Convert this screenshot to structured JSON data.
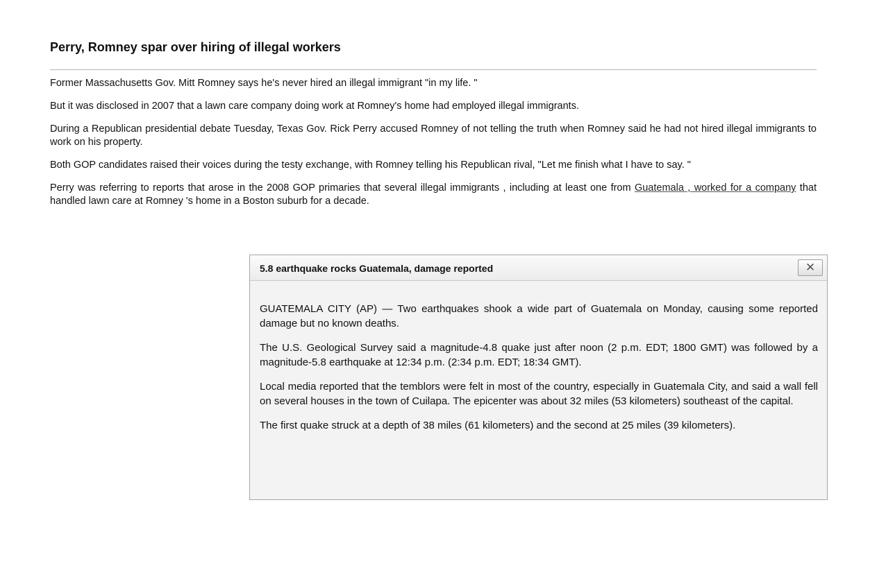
{
  "article": {
    "headline": "Perry, Romney spar over hiring of illegal workers",
    "paragraphs": [
      "Former Massachusetts Gov. Mitt Romney says he's never hired an illegal immigrant \"in my life. \"",
      "But it was disclosed in 2007 that a lawn care company doing work at Romney's home had employed illegal immigrants.",
      "During a Republican presidential debate Tuesday, Texas Gov. Rick Perry accused Romney of not telling the truth when Romney said he had not hired illegal immigrants to work on his property.",
      "Both GOP candidates raised their voices during the testy exchange, with Romney telling his Republican rival, \"Let me finish what I have to say. \""
    ],
    "last_paragraph": {
      "before": "Perry was referring to reports that arose in the 2008 GOP primaries that several illegal immigrants , including at least one from ",
      "link": "Guatemala , worked for a company",
      "after": " that handled lawn care at Romney 's home in a Boston suburb for a decade."
    }
  },
  "popup": {
    "title": "5.8 earthquake rocks Guatemala, damage reported",
    "close_glyph": "✕",
    "close_icon": "close-icon",
    "paragraphs": [
      "GUATEMALA CITY (AP) — Two earthquakes shook a wide part of Guatemala on Monday, causing some reported damage but no known deaths.",
      "The U.S. Geological Survey said a magnitude-4.8 quake just after noon (2 p.m. EDT; 1800 GMT) was followed by a magnitude-5.8 earthquake at 12:34 p.m. (2:34 p.m. EDT; 18:34 GMT).",
      "Local media reported that the temblors were felt in most of the country, especially in Guatemala City, and said a wall fell on several houses in the town of Cuilapa. The epicenter was about 32 miles (53 kilometers) southeast of the capital.",
      "The first quake struck at a depth of 38 miles (61 kilometers) and the second at 25 miles (39 kilometers)."
    ]
  }
}
